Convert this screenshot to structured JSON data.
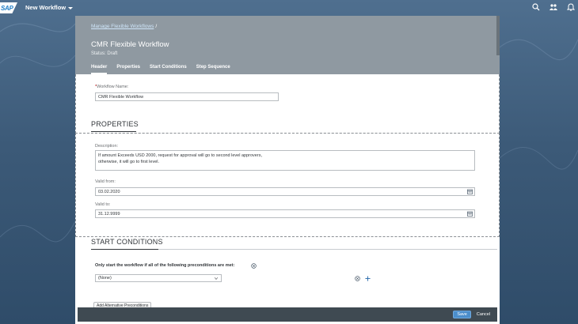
{
  "shell": {
    "logo_text": "SAP",
    "app_title": "New Workflow",
    "icons": [
      "search-icon",
      "people-icon",
      "bell-icon"
    ]
  },
  "header": {
    "breadcrumb_link": "Manage Flexible Workflows",
    "breadcrumb_sep": "/",
    "title": "CMR Flexible Workflow",
    "status": "Status: Draft",
    "tabs": [
      {
        "label": "Header",
        "active": true
      },
      {
        "label": "Properties",
        "active": false
      },
      {
        "label": "Start Conditions",
        "active": false
      },
      {
        "label": "Step Sequence",
        "active": false
      }
    ]
  },
  "header_section": {
    "required_mark": "*",
    "workflow_name_label": "Workflow Name:",
    "workflow_name_value": "CMR Flexible Workflow"
  },
  "properties": {
    "title": "PROPERTIES",
    "description_label": "Description:",
    "description_line1": "If amount Exceeds USD 2000, request for approval will go to second level approvers,",
    "description_line2": "otherwise, it will go to first level.",
    "valid_from_label": "Valid from:",
    "valid_from_value": "03.02.2020",
    "valid_to_label": "Valid to:",
    "valid_to_value": "31.12.9999"
  },
  "start_conditions": {
    "title": "START CONDITIONS",
    "precondition_text": "Only start the workflow if all of the following preconditions are met:",
    "select_value": "(None)",
    "add_alternative": "Add Alternative Preconditions"
  },
  "footer": {
    "save_label": "Save",
    "cancel_label": "Cancel"
  },
  "colors": {
    "shell_bg": "#3c5a78",
    "header_bg": "#8f99a1",
    "footer_bg": "#3f4a52",
    "accent": "#4b8ecb"
  }
}
